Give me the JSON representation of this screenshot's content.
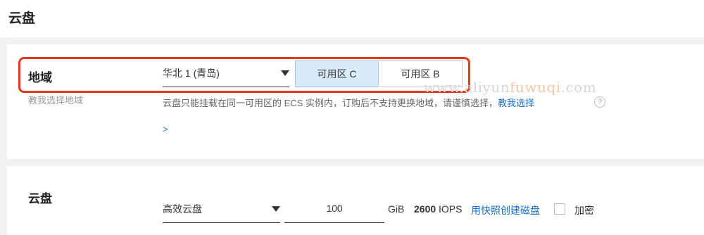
{
  "header": {
    "title": "云盘"
  },
  "region": {
    "label": "地域",
    "help_link": "教我选择地域",
    "selected_region": "华北 1 (青岛)",
    "zones": [
      {
        "label": "可用区 C",
        "active": true
      },
      {
        "label": "可用区 B",
        "active": false
      }
    ],
    "hint_text": "云盘只能挂载在同一可用区的 ECS 实例内，订购后不支持更换地域，请谨慎选择，",
    "hint_link": "教我选择",
    "help_icon": "?",
    "more_link": ">"
  },
  "watermark": {
    "prefix": "www.aliyun",
    "accent": "fuwuqi",
    "suffix": ".com"
  },
  "disk": {
    "label": "云盘",
    "type_selected": "高效云盘",
    "size_value": "100",
    "size_unit": "GiB",
    "iops_value": "2600",
    "iops_unit": "IOPS",
    "snapshot_link": "用快照创建磁盘",
    "encrypt_label": "加密"
  },
  "colors": {
    "accent_link": "#1a6fc7",
    "highlight_border": "#e53a1e",
    "active_zone_bg": "#d9ebfb"
  }
}
